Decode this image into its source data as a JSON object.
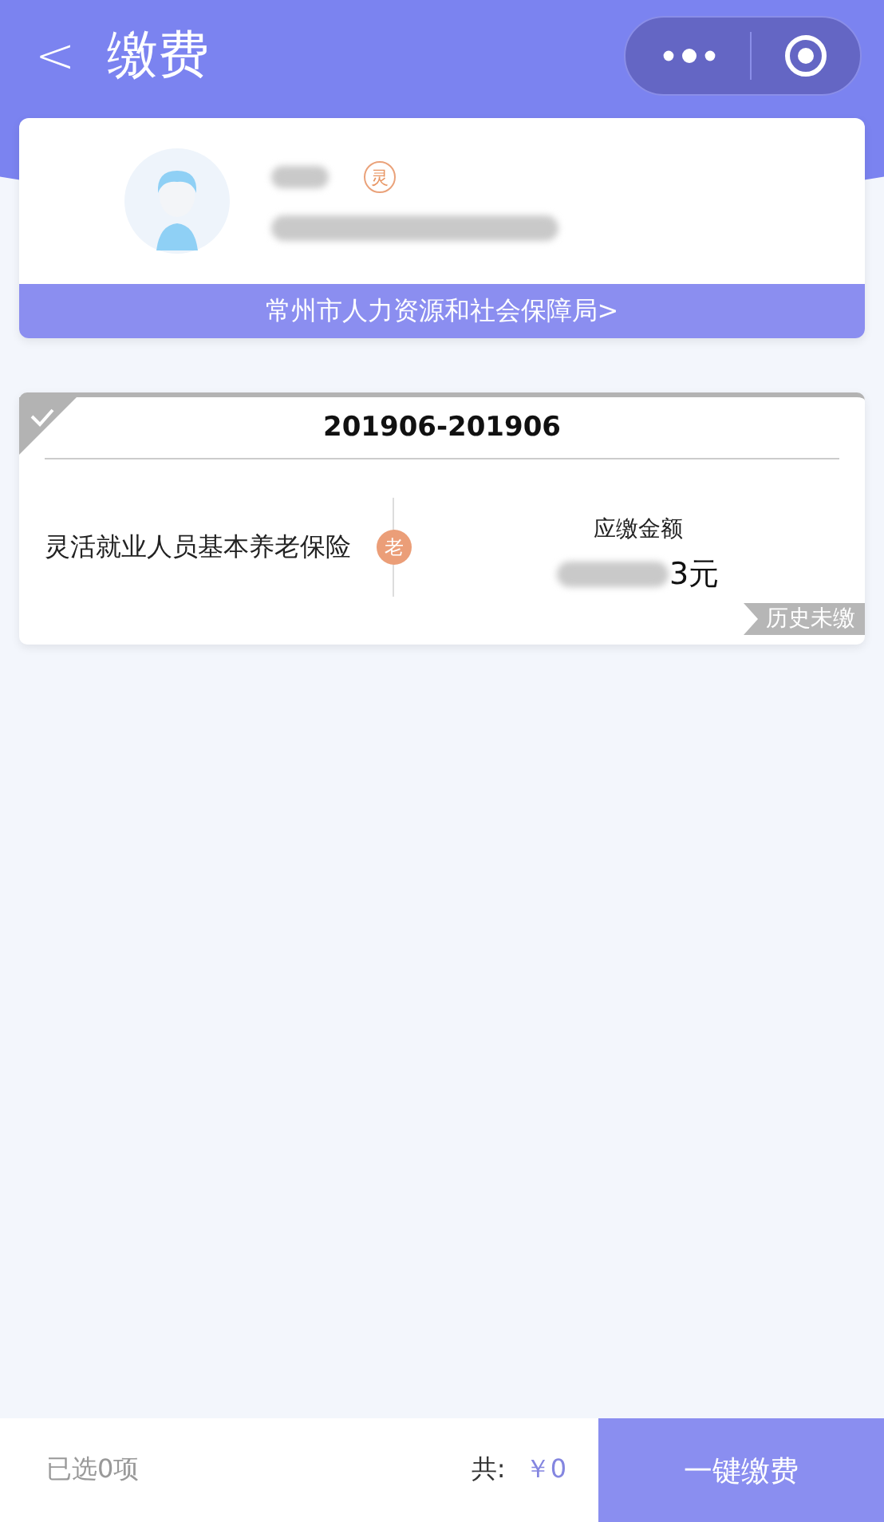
{
  "nav": {
    "back": "<",
    "title": "缴费"
  },
  "profile": {
    "tag": "灵",
    "agency": "常州市人力资源和社会保障局>"
  },
  "bills": [
    {
      "period": "201906-201906",
      "selected": false,
      "name": "灵活就业人员基本养老保险",
      "badge": "老",
      "amount_label": "应缴金额",
      "amount": "3元",
      "status": "历史未缴"
    }
  ],
  "footer": {
    "count": "已选0项",
    "total_label": "共:",
    "total": "￥0",
    "pay": "一键缴费"
  }
}
